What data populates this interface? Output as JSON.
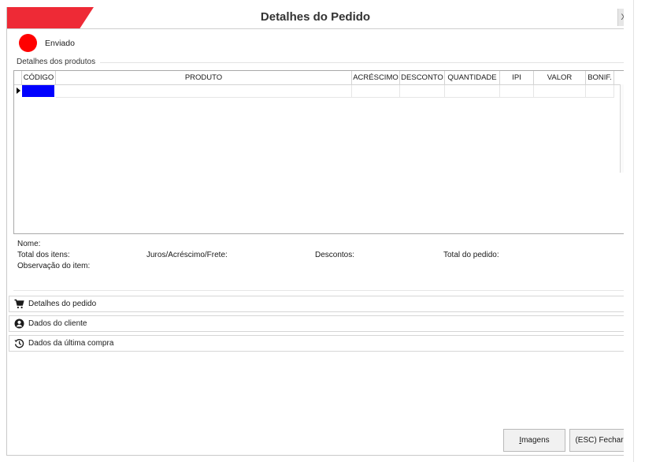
{
  "window": {
    "title": "Detalhes do Pedido",
    "close_label": "X"
  },
  "status": {
    "label": "Enviado",
    "color": "#ff0000"
  },
  "products": {
    "group_label": "Detalhes dos produtos",
    "columns": [
      "CÓDIGO",
      "PRODUTO",
      "ACRÉSCIMO",
      "DESCONTO",
      "QUANTIDADE",
      "IPI",
      "VALOR",
      "BONIF."
    ]
  },
  "item_info": {
    "nome": "Nome:",
    "total_itens": "Total dos itens:",
    "juros": "Juros/Acréscimo/Frete:",
    "descontos": "Descontos:",
    "total_pedido": "Total do pedido:",
    "observacao": "Observação do item:"
  },
  "panels": [
    {
      "icon": "cart-icon",
      "label": "Detalhes do pedido"
    },
    {
      "icon": "user-circle-icon",
      "label": "Dados do cliente"
    },
    {
      "icon": "history-icon",
      "label": "Dados da última compra"
    }
  ],
  "buttons": {
    "imagens_first": "I",
    "imagens_rest": "magens",
    "fechar": "(ESC) Fechar"
  },
  "colors": {
    "accent": "#ee2a36",
    "selection": "#0000ff"
  }
}
